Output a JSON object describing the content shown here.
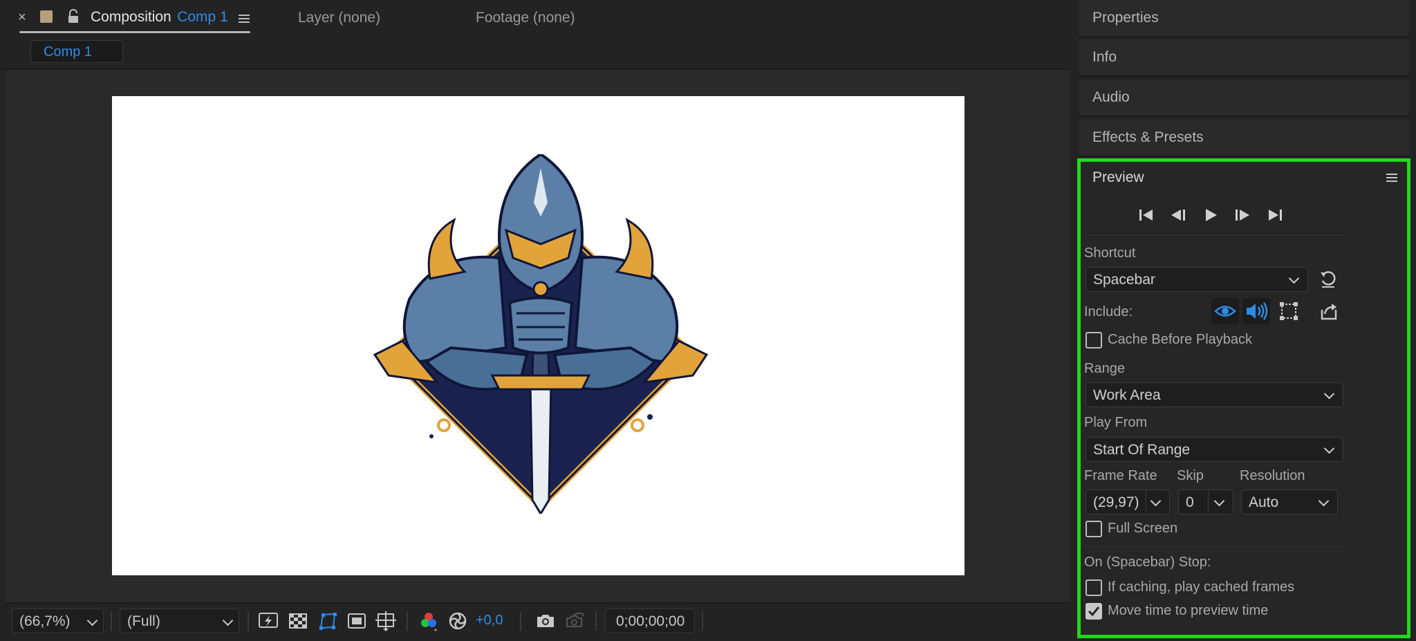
{
  "composition_panel": {
    "tabs": [
      {
        "prefix": "Composition",
        "name": "Comp 1"
      },
      {
        "label": "Layer (none)"
      },
      {
        "label": "Footage (none)"
      }
    ],
    "breadcrumb": "Comp 1",
    "close_glyph": "×"
  },
  "viewer_toolbar": {
    "zoom": "(66,7%)",
    "resolution": "(Full)",
    "exposure": "+0,0",
    "timecode": "0;00;00;00"
  },
  "right_panels": [
    {
      "title": "Properties"
    },
    {
      "title": "Info"
    },
    {
      "title": "Audio"
    },
    {
      "title": "Effects & Presets"
    }
  ],
  "preview": {
    "title": "Preview",
    "shortcut_label": "Shortcut",
    "shortcut_value": "Spacebar",
    "include_label": "Include:",
    "cache_before_playback": "Cache Before Playback",
    "range_label": "Range",
    "range_value": "Work Area",
    "play_from_label": "Play From",
    "play_from_value": "Start Of Range",
    "frame_rate_label": "Frame Rate",
    "frame_rate_value": "(29,97)",
    "skip_label": "Skip",
    "skip_value": "0",
    "resolution_label": "Resolution",
    "resolution_value": "Auto",
    "full_screen": "Full Screen",
    "on_stop_label": "On (Spacebar) Stop:",
    "if_caching": "If caching, play cached frames",
    "move_time": "Move time to preview time",
    "move_time_checked": true,
    "highlight_color": "#21d91b",
    "accent_color": "#2d8ceb"
  },
  "icons": [
    "close-icon",
    "solid-color-icon",
    "lock-icon",
    "menu-icon",
    "first-frame-icon",
    "prev-frame-icon",
    "play-icon",
    "next-frame-icon",
    "last-frame-icon",
    "reset-icon",
    "video-eye-icon",
    "audio-speaker-icon",
    "overlay-bounds-icon",
    "export-icon",
    "fast-preview-icon",
    "transparency-grid-icon",
    "mask-path-icon",
    "region-of-interest-icon",
    "grid-guides-icon",
    "color-channels-icon",
    "exposure-icon",
    "snapshot-camera-icon",
    "show-snapshot-icon",
    "knight-artwork"
  ]
}
